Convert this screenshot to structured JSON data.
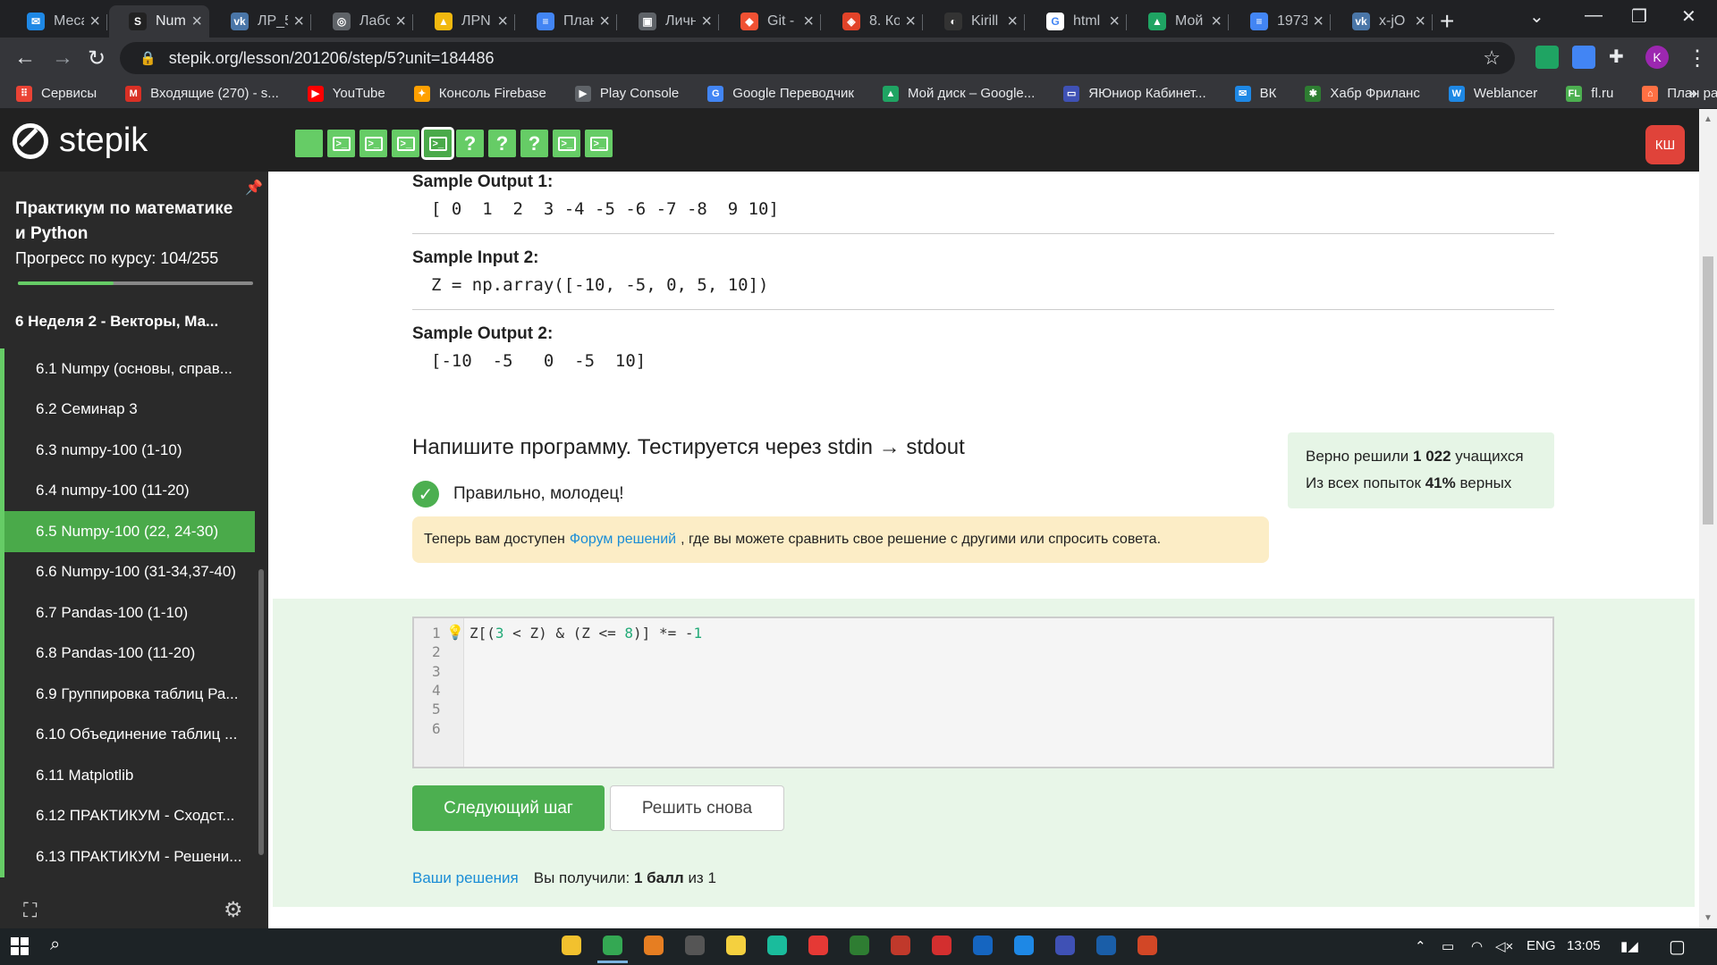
{
  "browser": {
    "tabs": [
      {
        "title": "Меса",
        "icon": "messenger-icon",
        "color": "#1e88e5",
        "glyph": "✉"
      },
      {
        "title": "Num",
        "icon": "stepik-icon",
        "color": "#222222",
        "glyph": "S",
        "active": true
      },
      {
        "title": "ЛР_5",
        "icon": "vk-icon",
        "color": "#4a76a8",
        "glyph": "vk"
      },
      {
        "title": "Лабо",
        "icon": "globe-icon",
        "color": "#5f6368",
        "glyph": "◎"
      },
      {
        "title": "ЛРN",
        "icon": "google-drive-icon",
        "color": "#f2b90f",
        "glyph": "▲"
      },
      {
        "title": "План",
        "icon": "google-docs-icon",
        "color": "#4285f4",
        "glyph": "≡"
      },
      {
        "title": "Личн",
        "icon": "document-icon",
        "color": "#5f6368",
        "glyph": "▣"
      },
      {
        "title": "Git -",
        "icon": "git-icon",
        "color": "#f05133",
        "glyph": "◆"
      },
      {
        "title": "8. Ко",
        "icon": "gitlab-icon",
        "color": "#e24329",
        "glyph": "◈"
      },
      {
        "title": "Kirill",
        "icon": "github-icon",
        "color": "#333333",
        "glyph": "◐"
      },
      {
        "title": "html",
        "icon": "google-icon",
        "color": "#ffffff",
        "glyph": "G"
      },
      {
        "title": "Мой",
        "icon": "google-drive-icon",
        "color": "#1fa463",
        "glyph": "▲"
      },
      {
        "title": "1973",
        "icon": "google-docs-icon",
        "color": "#4285f4",
        "glyph": "≡"
      },
      {
        "title": "x-jO",
        "icon": "vk-icon",
        "color": "#4a76a8",
        "glyph": "vk"
      }
    ],
    "url": "stepik.org/lesson/201206/step/5?unit=184486",
    "profile_initial": "K",
    "bookmarks": [
      {
        "label": "Сервисы",
        "icon": "apps-grid-icon",
        "color": "#ea4335",
        "glyph": "⠿"
      },
      {
        "label": "Входящие (270) - s...",
        "icon": "gmail-icon",
        "color": "#d93025",
        "glyph": "M"
      },
      {
        "label": "YouTube",
        "icon": "youtube-icon",
        "color": "#ff0000",
        "glyph": "▶"
      },
      {
        "label": "Консоль Firebase",
        "icon": "firebase-icon",
        "color": "#ffa000",
        "glyph": "✦"
      },
      {
        "label": "Play Console",
        "icon": "play-console-icon",
        "color": "#5f6368",
        "glyph": "▶"
      },
      {
        "label": "Google Переводчик",
        "icon": "google-translate-icon",
        "color": "#4285f4",
        "glyph": "G"
      },
      {
        "label": "Мой диск – Google...",
        "icon": "google-drive-icon",
        "color": "#1fa463",
        "glyph": "▲"
      },
      {
        "label": "ЯЮниор Кабинет...",
        "icon": "cabinet-icon",
        "color": "#3f51b5",
        "glyph": "▭"
      },
      {
        "label": "ВК",
        "icon": "vk-icon",
        "color": "#1e88e5",
        "glyph": "✉"
      },
      {
        "label": "Хабр Фриланс",
        "icon": "habr-icon",
        "color": "#2e7d32",
        "glyph": "✱"
      },
      {
        "label": "Weblancer",
        "icon": "weblancer-icon",
        "color": "#1e88e5",
        "glyph": "W"
      },
      {
        "label": "fl.ru",
        "icon": "flru-icon",
        "color": "#4caf50",
        "glyph": "FL"
      },
      {
        "label": "План развития",
        "icon": "plan-icon",
        "color": "#ff7043",
        "glyph": "⌂"
      }
    ],
    "bookmarks_more": "»"
  },
  "header": {
    "logo_text": "stepik",
    "steps": [
      "done",
      "code",
      "code",
      "code",
      "code-current",
      "quiz",
      "quiz",
      "quiz",
      "code",
      "code"
    ],
    "avatar_initials": "КШ"
  },
  "sidebar": {
    "course_title": "Практикум по математике и Python",
    "progress_label": "Прогресс по курсу:",
    "progress_value": "104/255",
    "progress_fraction": 0.408,
    "module_title": "6  Неделя 2 - Векторы, Ма...",
    "lessons": [
      {
        "label": "6.1  Numpy (основы, справ..."
      },
      {
        "label": "6.2  Семинар 3"
      },
      {
        "label": "6.3  numpy-100 (1-10)"
      },
      {
        "label": "6.4  numpy-100 (11-20)"
      },
      {
        "label": "6.5  Numpy-100 (22, 24-30)",
        "active": true
      },
      {
        "label": "6.6  Numpy-100 (31-34,37-40)"
      },
      {
        "label": "6.7  Pandas-100 (1-10)"
      },
      {
        "label": "6.8  Pandas-100 (11-20)"
      },
      {
        "label": "6.9  Группировка таблиц Ра..."
      },
      {
        "label": "6.10  Объединение таблиц ..."
      },
      {
        "label": "6.11  Matplotlib"
      },
      {
        "label": "6.12  ПРАКТИКУМ - Сходст..."
      },
      {
        "label": "6.13  ПРАКТИКУМ - Решени..."
      }
    ]
  },
  "main": {
    "sample_output_1_label": "Sample Output 1:",
    "sample_output_1": "[ 0  1  2  3 -4 -5 -6 -7 -8  9 10]",
    "sample_input_2_label": "Sample Input 2:",
    "sample_input_2": "Z = np.array([-10, -5, 0, 5, 10])",
    "sample_output_2_label": "Sample Output 2:",
    "sample_output_2": "[-10  -5   0  -5  10]",
    "task_title": "Напишите программу. Тестируется через stdin → stdout",
    "stats_line1_pre": "Верно решили",
    "stats_line1_bold": "1 022",
    "stats_line1_post": "учащихся",
    "stats_line2_pre": "Из всех попыток",
    "stats_line2_bold": "41%",
    "stats_line2_post": "верных",
    "correct_message": "Правильно, молодец!",
    "notice_pre": "Теперь вам доступен",
    "notice_link": "Форум решений",
    "notice_post": ", где вы можете сравнить свое решение с другими или спросить совета.",
    "code_lines": [
      "1",
      "2",
      "3",
      "4",
      "5",
      "6"
    ],
    "code_tokens": {
      "a": "Z[(",
      "n3": "3",
      "b": " < Z) & (Z <= ",
      "n8": "8",
      "c": ")] *= -",
      "n1": "1"
    },
    "next_button": "Следующий шаг",
    "retry_button": "Решить снова",
    "your_solutions_link": "Ваши решения",
    "score_pre": "Вы получили:",
    "score_bold": "1 балл",
    "score_post": "из 1"
  },
  "taskbar": {
    "apps": [
      {
        "icon": "file-explorer-icon",
        "color": "#f2c12e"
      },
      {
        "icon": "chrome-icon",
        "color": "#34a853",
        "running": true
      },
      {
        "icon": "app-orange-icon",
        "color": "#e67e22"
      },
      {
        "icon": "obs-icon",
        "color": "#555555"
      },
      {
        "icon": "app-yellow-icon",
        "color": "#f4d03f"
      },
      {
        "icon": "app-teal-icon",
        "color": "#1abc9c"
      },
      {
        "icon": "media-player-icon",
        "color": "#e53935"
      },
      {
        "icon": "xbox-icon",
        "color": "#2e7d32"
      },
      {
        "icon": "dev-tool-icon",
        "color": "#c0392b"
      },
      {
        "icon": "acrobat-icon",
        "color": "#d32f2f"
      },
      {
        "icon": "photoshop-icon",
        "color": "#1565c0"
      },
      {
        "icon": "sourcetree-icon",
        "color": "#1e88e5"
      },
      {
        "icon": "virtualbox-icon",
        "color": "#3f51b5"
      },
      {
        "icon": "word-icon",
        "color": "#1a5ea8"
      },
      {
        "icon": "powerpoint-icon",
        "color": "#d24726"
      }
    ],
    "language": "ENG",
    "time": "13:05"
  }
}
